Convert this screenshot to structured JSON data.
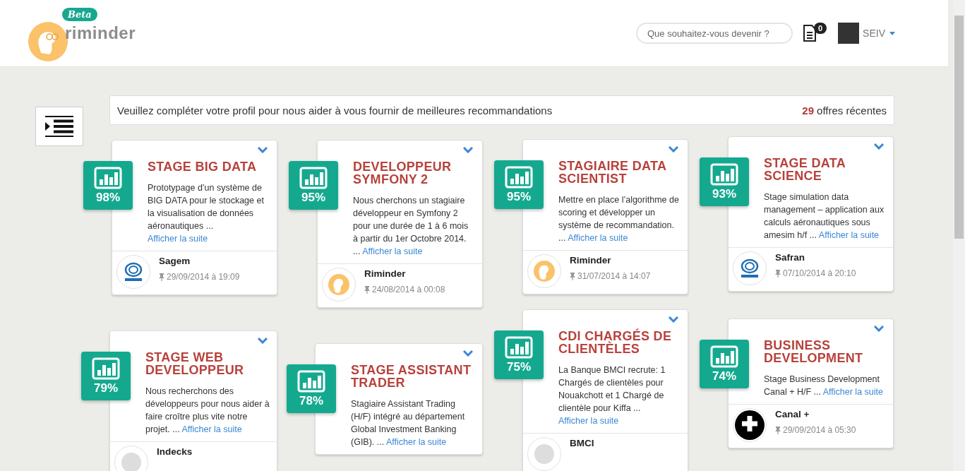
{
  "header": {
    "logo_badge": "Beta",
    "logo_text": "riminder",
    "search": {
      "placeholder": "Que souhaitez-vous devenir ?"
    },
    "notifications": "0",
    "user": "SEIV"
  },
  "banner": {
    "message": "Veuillez compléter votre profil pour nous aider à vous fournir de meilleures recommandations",
    "count": "29",
    "count_label": "offres récentes"
  },
  "offers": [
    {
      "score": "98%",
      "title": "STAGE BIG DATA",
      "description": "Prototypage d’un système de BIG DATA pour le stockage et la visualisation de données aéronautiques ...",
      "link": "Afficher la suite",
      "company": "Sagem",
      "kind": "safran",
      "date": "29/09/2014 à 19:09"
    },
    {
      "score": "95%",
      "title": "DEVELOPPEUR SYMFONY 2",
      "description": "Nous cherchons un stagiaire développeur en Symfony 2 pour une durée de 1 à 6 mois à partir du 1er Octobre 2014. ...",
      "link": "Afficher la suite",
      "company": "Riminder",
      "kind": "riminder",
      "date": "24/08/2014 à 00:08"
    },
    {
      "score": "95%",
      "title": "STAGIAIRE DATA SCIENTIST",
      "description": "Mettre en place l’algorithme de scoring et développer un système de recommandation. ...",
      "link": "Afficher la suite",
      "company": "Riminder",
      "kind": "riminder",
      "date": "31/07/2014 à 14:07"
    },
    {
      "score": "93%",
      "title": "STAGE DATA SCIENCE",
      "description": "Stage simulation data management – application aux calculs aéronautiques sous amesim h/f ...",
      "link": "Afficher la suite",
      "company": "Safran",
      "kind": "safran",
      "date": "07/10/2014 à 20:10"
    },
    {
      "score": "79%",
      "title": "STAGE WEB DEVELOPPEUR",
      "description": "Nous recherchons des développeurs pour nous aider à faire croître plus vite notre projet. ...",
      "link": "Afficher la suite",
      "company": "Indecks",
      "kind": "generic"
    },
    {
      "score": "78%",
      "title": "STAGE ASSISTANT TRADER",
      "description": "Stagiaire Assistant Trading (H/F) intégré au département Global Investment Banking (GIB). ...",
      "link": "Afficher la suite"
    },
    {
      "score": "75%",
      "title": "CDI CHARGÉS DE CLIENTÈLES",
      "description": "La Banque BMCI recrute: 1 Chargés de clientèles pour Nouakchott et 1 Chargé de clientèle pour Kiffa ...",
      "link": "Afficher la suite",
      "company": "BMCI",
      "kind": "generic"
    },
    {
      "score": "74%",
      "title": "BUSINESS DEVELOPMENT",
      "description": "Stage Business Development Canal + H/F ...",
      "link": "Afficher la suite",
      "company": "Canal +",
      "kind": "canal",
      "date": "29/09/2014 à 05:30"
    }
  ]
}
